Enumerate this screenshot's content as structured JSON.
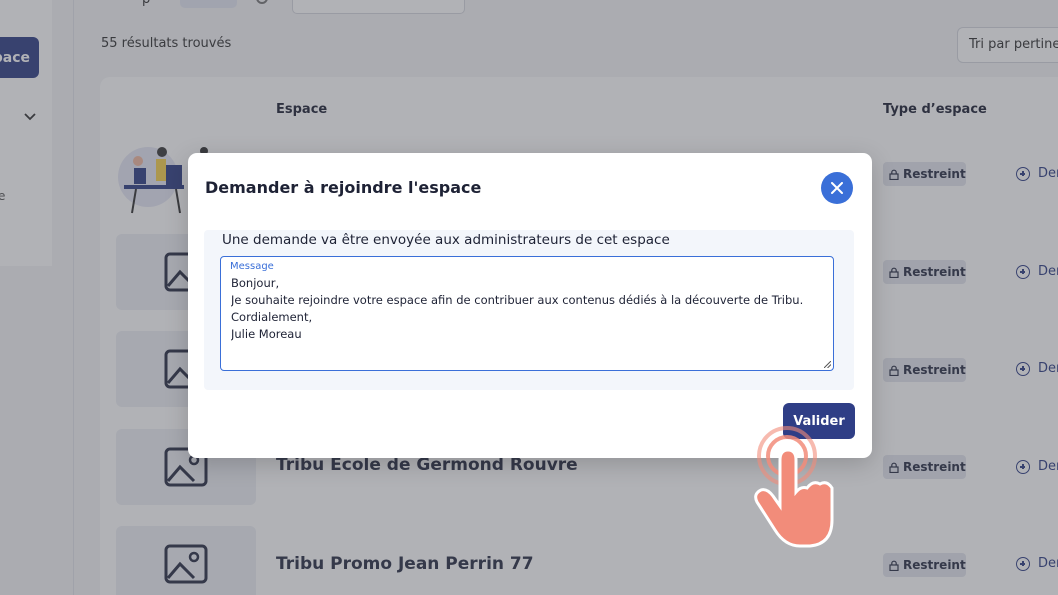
{
  "sidebar": {
    "button_label": "pace",
    "stray_char": "e"
  },
  "topbar": {
    "stray_char": "p"
  },
  "results": {
    "count_text": "55 résultats trouvés",
    "sort_label": "Tri par pertinence"
  },
  "table": {
    "columns": {
      "space": "Espace",
      "type": "Type d’espace"
    },
    "rows": [
      {
        "title": "",
        "type": "Restreint",
        "action": "Demander"
      },
      {
        "title": "",
        "type": "Restreint",
        "action": "Demander"
      },
      {
        "title": "",
        "type": "Restreint",
        "action": "Demander"
      },
      {
        "title": "Tribu Ecole de Germond Rouvre",
        "type": "Restreint",
        "action": "Demander"
      },
      {
        "title": "Tribu Promo Jean Perrin 77",
        "type": "Restreint",
        "action": "Demander"
      }
    ]
  },
  "modal": {
    "title": "Demander à rejoindre l'espace",
    "description": "Une demande va être envoyée aux administrateurs de cet espace",
    "message_label": "Message",
    "message_value": "Bonjour,\nJe souhaite rejoindre votre espace afin de contribuer aux contenus dédiés à la découverte de Tribu.\nCordialement,\nJulie Moreau",
    "submit_label": "Valider"
  },
  "colors": {
    "primary": "#2f3e86",
    "accent": "#3a6fd8",
    "hand": "#f28c7a"
  },
  "icons": {
    "close": "close-icon",
    "lock": "lock-icon",
    "image": "image-placeholder-icon",
    "plus": "plus-circle-icon",
    "chevron": "chevron-down-icon"
  }
}
